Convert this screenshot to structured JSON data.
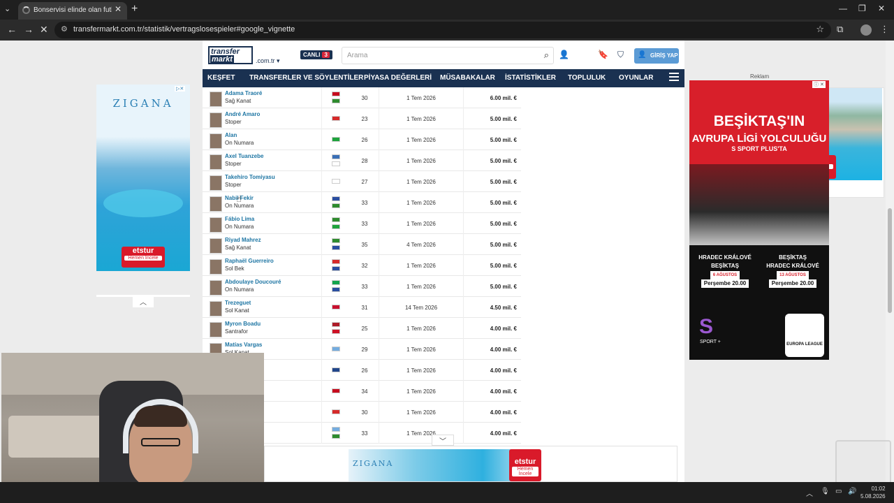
{
  "browser": {
    "tab_title": "Bonservisi elinde olan futbolcul",
    "url": "transfermarkt.com.tr/statistik/vertragslosespieler#google_vignette"
  },
  "site": {
    "logo_top": "transfer",
    "logo_bottom": "markt",
    "domain": ".com.tr",
    "live_label": "CANLI",
    "live_count": "3",
    "search_placeholder": "Arama",
    "login_label": "GİRİŞ YAP",
    "nav": [
      "KEŞFET",
      "TRANSFERLER VE SÖYLENTİLER",
      "PİYASA DEĞERLERİ",
      "MÜSABAKALAR",
      "İSTATİSTİKLER",
      "TOPLULUK",
      "OYUNLAR"
    ]
  },
  "players": [
    {
      "name": "Adama Traoré",
      "position": "Sağ Kanat",
      "age": "30",
      "contract": "1 Tem 2026",
      "value": "6.00 mil. €",
      "flags": [
        "#c60b1e",
        "#2e8b2e"
      ]
    },
    {
      "name": "André Amaro",
      "position": "Stoper",
      "age": "23",
      "contract": "1 Tem 2026",
      "value": "5.00 mil. €",
      "flags": [
        "#d62a2a"
      ]
    },
    {
      "name": "Alan",
      "position": "On Numara",
      "age": "26",
      "contract": "1 Tem 2026",
      "value": "5.00 mil. €",
      "flags": [
        "#1ea33c"
      ]
    },
    {
      "name": "Axel Tuanzebe",
      "position": "Stoper",
      "age": "28",
      "contract": "1 Tem 2026",
      "value": "5.00 mil. €",
      "flags": [
        "#3a6fb6",
        "#ffffff"
      ]
    },
    {
      "name": "Takehiro Tomiyasu",
      "position": "Stoper",
      "age": "27",
      "contract": "1 Tem 2026",
      "value": "5.00 mil. €",
      "flags": [
        "#ffffff"
      ]
    },
    {
      "name": "Nabil Fekir",
      "position": "On Numara",
      "age": "33",
      "contract": "1 Tem 2026",
      "value": "5.00 mil. €",
      "flags": [
        "#2a4ea0",
        "#2e8b2e"
      ]
    },
    {
      "name": "Fábio Lima",
      "position": "On Numara",
      "age": "33",
      "contract": "1 Tem 2026",
      "value": "5.00 mil. €",
      "flags": [
        "#2e8b2e",
        "#1ea33c"
      ]
    },
    {
      "name": "Riyad Mahrez",
      "position": "Sağ Kanat",
      "age": "35",
      "contract": "4 Tem 2026",
      "value": "5.00 mil. €",
      "flags": [
        "#2e8b2e",
        "#2a4ea0"
      ]
    },
    {
      "name": "Raphaël Guerreiro",
      "position": "Sol Bek",
      "age": "32",
      "contract": "1 Tem 2026",
      "value": "5.00 mil. €",
      "flags": [
        "#d62a2a",
        "#2a4ea0"
      ]
    },
    {
      "name": "Abdoulaye Doucouré",
      "position": "On Numara",
      "age": "33",
      "contract": "1 Tem 2026",
      "value": "5.00 mil. €",
      "flags": [
        "#14a44d",
        "#2a4ea0"
      ]
    },
    {
      "name": "Trezeguet",
      "position": "Sol Kanat",
      "age": "31",
      "contract": "14 Tem 2026",
      "value": "4.50 mil. €",
      "flags": [
        "#c8102e"
      ]
    },
    {
      "name": "Myron Boadu",
      "position": "Santrafor",
      "age": "25",
      "contract": "1 Tem 2026",
      "value": "4.00 mil. €",
      "flags": [
        "#ae1c28",
        "#ce1126"
      ]
    },
    {
      "name": "Matías Vargas",
      "position": "Sol Kanat",
      "age": "29",
      "contract": "1 Tem 2026",
      "value": "4.00 mil. €",
      "flags": [
        "#74acdf"
      ]
    },
    {
      "name": "",
      "position": "",
      "age": "26",
      "contract": "1 Tem 2026",
      "value": "4.00 mil. €",
      "flags": [
        "#21468b"
      ]
    },
    {
      "name": "",
      "position": "",
      "age": "34",
      "contract": "1 Tem 2026",
      "value": "4.00 mil. €",
      "flags": [
        "#c60b1e"
      ]
    },
    {
      "name": "",
      "position": "",
      "age": "30",
      "contract": "1 Tem 2026",
      "value": "4.00 mil. €",
      "flags": [
        "#d62a2a"
      ]
    },
    {
      "name": "",
      "position": "",
      "age": "33",
      "contract": "1 Tem 2026",
      "value": "4.00 mil. €",
      "flags": [
        "#74acdf",
        "#2e8b2e"
      ]
    }
  ],
  "ads": {
    "label": "Reklam",
    "left_brand": "ZIGANA",
    "ets_name": "etstur",
    "ets_cta": "Hemen İncele",
    "sport_title": "BEŞİKTAŞ'IN",
    "sport_subtitle": "AVRUPA LİGİ YOLCULUĞU",
    "sport_channel": "S SPORT PLUS'TA",
    "match1_home": "HRADEC KRÁLOVÉ",
    "match1_away": "BEŞİKTAŞ",
    "match1_date": "6 AĞUSTOS",
    "match1_time": "Perşembe 20.00",
    "match2_home": "BEŞİKTAŞ",
    "match2_away": "HRADEC KRÁLOVÉ",
    "match2_date": "13 AĞUSTOS",
    "match2_time": "Perşembe 20.00",
    "sport_logo": "S",
    "sport_logo_sub": "SPORT +",
    "uel_label": "EUROPA LEAGUE"
  },
  "taskbar": {
    "time": "01:02",
    "date": "5.08.2026"
  }
}
